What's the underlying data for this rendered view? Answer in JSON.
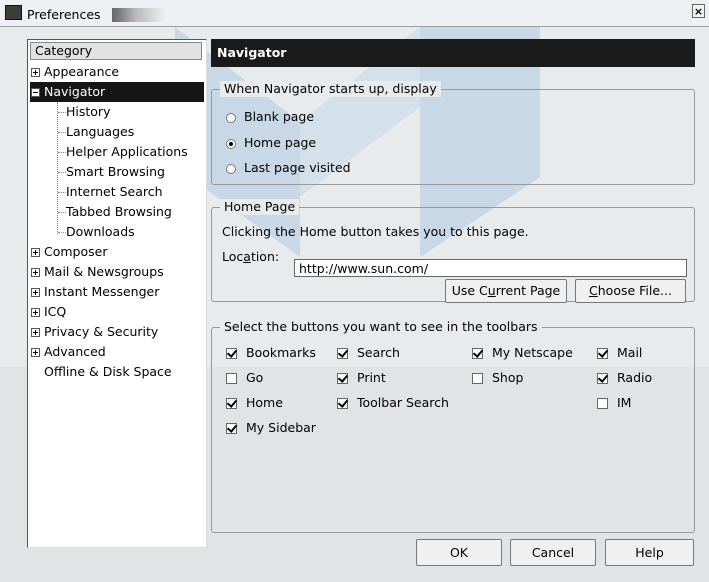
{
  "window": {
    "title": "Preferences",
    "close_symbol": "×"
  },
  "sidebar": {
    "header": "Category",
    "items": [
      {
        "label": "Appearance",
        "expander": "plus"
      },
      {
        "label": "Navigator",
        "expander": "minus",
        "selected": true
      },
      {
        "label": "History",
        "child": true
      },
      {
        "label": "Languages",
        "child": true
      },
      {
        "label": "Helper Applications",
        "child": true
      },
      {
        "label": "Smart Browsing",
        "child": true
      },
      {
        "label": "Internet Search",
        "child": true
      },
      {
        "label": "Tabbed Browsing",
        "child": true
      },
      {
        "label": "Downloads",
        "child": true
      },
      {
        "label": "Composer",
        "expander": "plus"
      },
      {
        "label": "Mail & Newsgroups",
        "expander": "plus"
      },
      {
        "label": "Instant Messenger",
        "expander": "plus"
      },
      {
        "label": "ICQ",
        "expander": "plus"
      },
      {
        "label": "Privacy & Security",
        "expander": "plus"
      },
      {
        "label": "Advanced",
        "expander": "plus"
      },
      {
        "label": "Offline & Disk Space"
      }
    ]
  },
  "panel": {
    "title": "Navigator",
    "startup": {
      "legend": "When Navigator starts up, display",
      "options": [
        {
          "label": "Blank page",
          "selected": false
        },
        {
          "label": "Home page",
          "selected": true
        },
        {
          "label": "Last page visited",
          "selected": false
        }
      ]
    },
    "homepage": {
      "legend": "Home Page",
      "description": "Clicking the Home button takes you to this page.",
      "location_label_pre": "Loc",
      "location_label_mn": "a",
      "location_label_post": "tion:",
      "location_value": "http://www.sun.com/",
      "use_current_pre": "Use C",
      "use_current_mn": "u",
      "use_current_post": "rrent Page",
      "choose_file_mn": "C",
      "choose_file_post": "hoose File..."
    },
    "toolbar": {
      "legend": "Select the buttons you want to see in the toolbars",
      "buttons": [
        {
          "label": "Bookmarks",
          "checked": true
        },
        {
          "label": "Search",
          "checked": true
        },
        {
          "label": "My Netscape",
          "checked": true
        },
        {
          "label": "Mail",
          "checked": true
        },
        {
          "label": "Go",
          "checked": false
        },
        {
          "label": "Print",
          "checked": true
        },
        {
          "label": "Shop",
          "checked": false
        },
        {
          "label": "Radio",
          "checked": true
        },
        {
          "label": "Home",
          "checked": true
        },
        {
          "label": "Toolbar Search",
          "checked": true
        },
        {
          "label": "IM",
          "checked": false
        },
        {
          "label": "My Sidebar",
          "checked": true
        }
      ]
    }
  },
  "footer": {
    "ok": "OK",
    "cancel": "Cancel",
    "help": "Help"
  }
}
